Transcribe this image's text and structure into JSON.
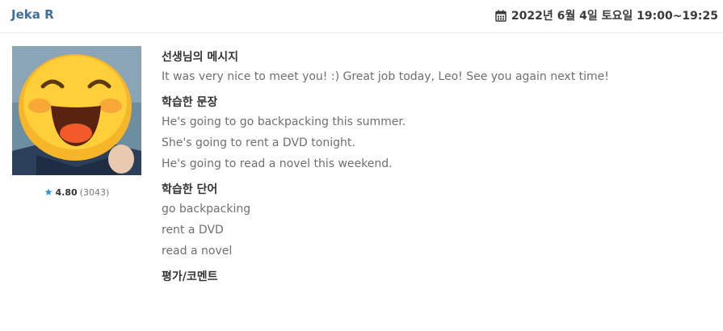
{
  "header": {
    "teacher_name": "Jeka R",
    "datetime": "2022년 6월 4일 토요일 19:00~19:25",
    "calendar_icon": "calendar-icon"
  },
  "profile": {
    "avatar": "teacher-photo-emoji-face",
    "rating": {
      "star_icon": "star-icon",
      "star_color": "#1e93d6",
      "score": "4.80",
      "count": "(3043)"
    }
  },
  "sections": {
    "message": {
      "title": "선생님의 메시지",
      "text": "It was very nice to meet you! :) Great job today, Leo! See you again next time!"
    },
    "sentences": {
      "title": "학습한 문장",
      "items": [
        "He's going to go backpacking this summer.",
        "She's going to rent a DVD tonight.",
        "He's going to read a novel this weekend."
      ]
    },
    "words": {
      "title": "학습한 단어",
      "items": [
        "go backpacking",
        "rent a DVD",
        "read a novel"
      ]
    },
    "comment": {
      "title": "평가/코멘트"
    }
  },
  "colors": {
    "name": "#3e6e9a",
    "heading": "#333333",
    "body_text": "#6f6f6f"
  }
}
